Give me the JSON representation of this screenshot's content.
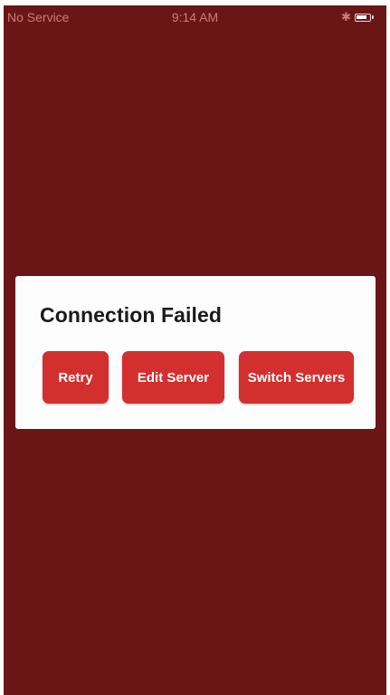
{
  "status_bar": {
    "carrier": "No Service",
    "time": "9:14 AM",
    "bluetooth_icon": "bluetooth-icon",
    "battery_icon": "battery-icon"
  },
  "dialog": {
    "title": "Connection Failed",
    "buttons": {
      "retry": "Retry",
      "edit_server": "Edit Server",
      "switch_servers": "Switch Servers"
    }
  },
  "colors": {
    "background": "#6b1616",
    "dialog": "#fdfdfd",
    "button": "#d32f2f",
    "button_text": "#ffffff"
  }
}
